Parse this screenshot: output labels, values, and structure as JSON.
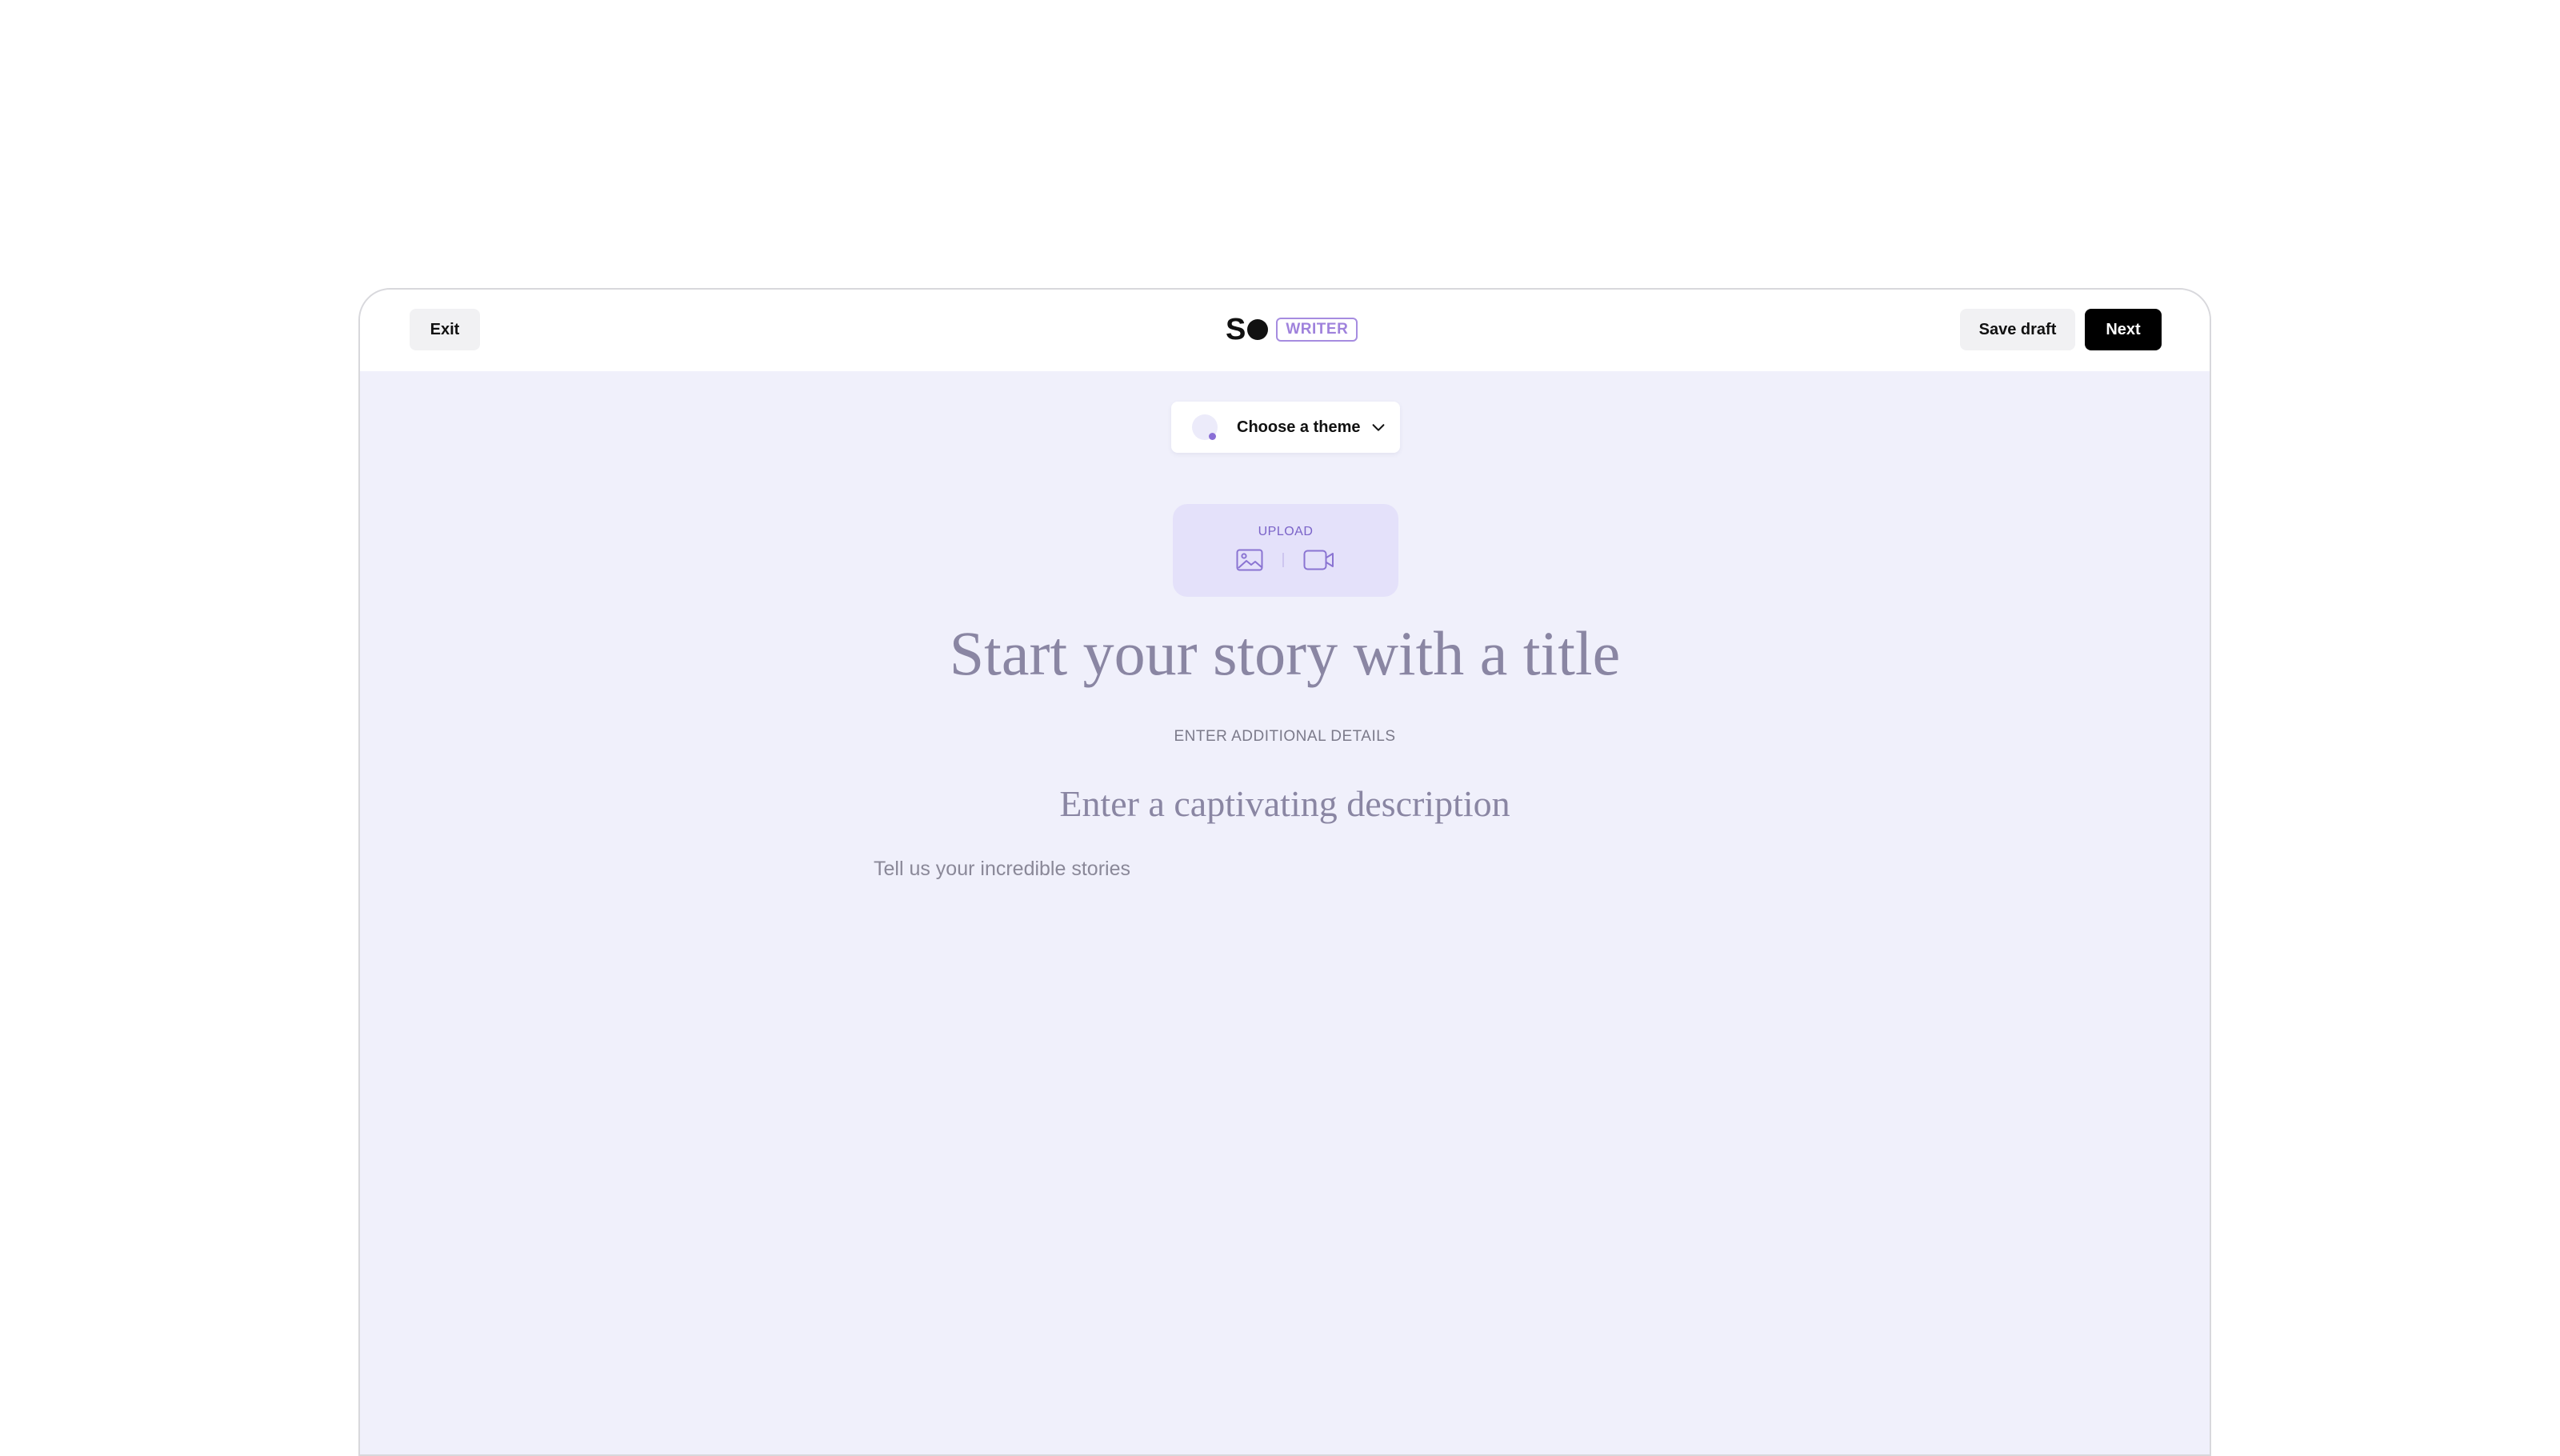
{
  "header": {
    "exit_label": "Exit",
    "logo_text": "S",
    "logo_badge": "WRITER",
    "save_draft_label": "Save draft",
    "next_label": "Next"
  },
  "theme": {
    "label": "Choose a theme",
    "accent_color": "#8a6fd6"
  },
  "upload": {
    "label": "UPLOAD",
    "icons": [
      "image-icon",
      "video-icon"
    ]
  },
  "editor": {
    "title_placeholder": "Start your story with a title",
    "details_label": "ENTER ADDITIONAL DETAILS",
    "description_placeholder": "Enter a captivating description",
    "body_placeholder": "Tell us your incredible stories"
  },
  "colors": {
    "canvas_background": "#f0f0fb",
    "upload_background": "#e4e1fa",
    "brand_purple": "#9f82dc"
  }
}
